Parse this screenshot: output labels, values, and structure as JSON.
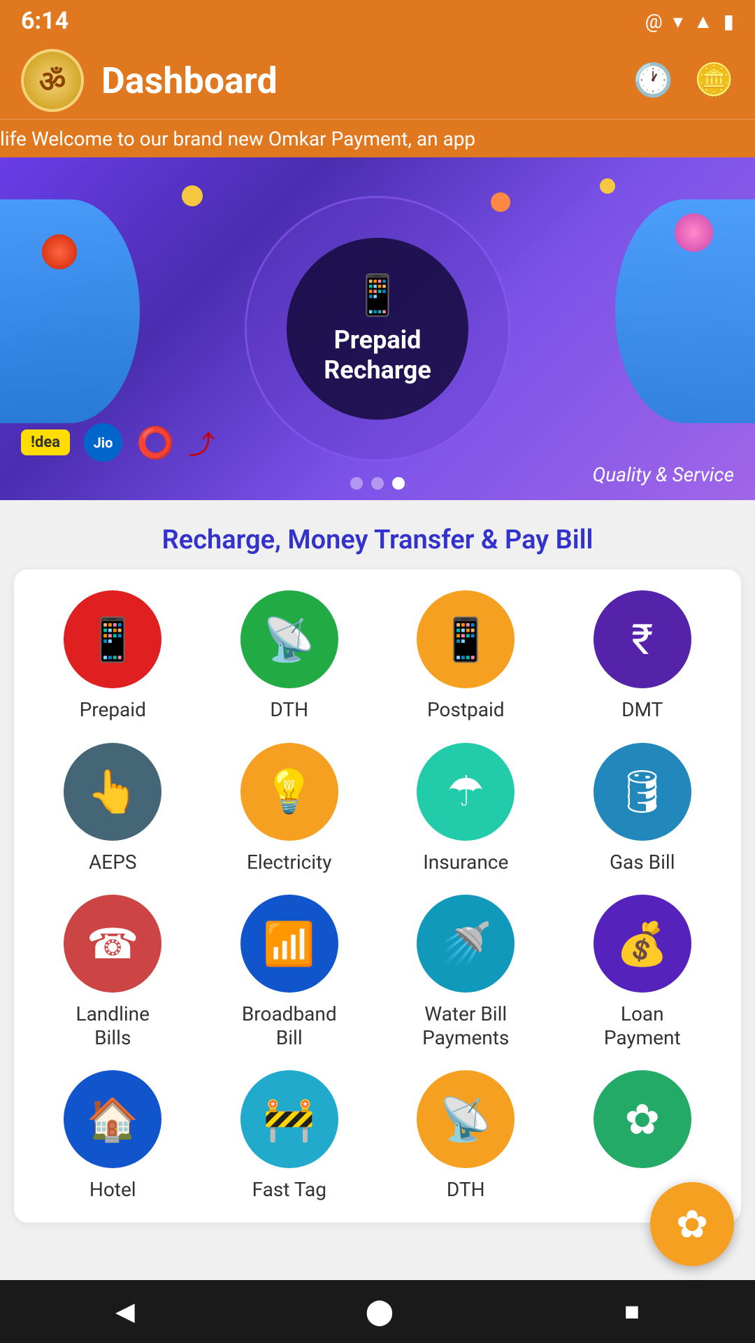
{
  "status": {
    "time": "6:14",
    "wifi_icon": "wifi",
    "signal_icon": "signal",
    "battery_icon": "battery"
  },
  "header": {
    "logo_text": "ॐ",
    "title": "Dashboard",
    "history_icon": "history",
    "wallet_icon": "wallet"
  },
  "marquee": {
    "text": "life   Welcome to our brand new Omkar Payment, an app"
  },
  "banner": {
    "title": "Prepaid\nRecharge",
    "phone_icon": "📱",
    "quality_text": "Quality & Service",
    "brands": [
      "!dea",
      "Jio",
      "Vodafone",
      "Airtel"
    ]
  },
  "section": {
    "title": "Recharge, Money Transfer & Pay Bill"
  },
  "services": [
    {
      "id": "prepaid",
      "label": "Prepaid",
      "icon": "📱",
      "color_class": "ic-prepaid"
    },
    {
      "id": "dth",
      "label": "DTH",
      "icon": "📡",
      "color_class": "ic-dth"
    },
    {
      "id": "postpaid",
      "label": "Postpaid",
      "icon": "📱",
      "color_class": "ic-postpaid"
    },
    {
      "id": "dmt",
      "label": "DMT",
      "icon": "₹",
      "color_class": "ic-dmt"
    },
    {
      "id": "aeps",
      "label": "AEPS",
      "icon": "👆",
      "color_class": "ic-aeps"
    },
    {
      "id": "electricity",
      "label": "Electricity",
      "icon": "💡",
      "color_class": "ic-electricity"
    },
    {
      "id": "insurance",
      "label": "Insurance",
      "icon": "☂",
      "color_class": "ic-insurance"
    },
    {
      "id": "gas",
      "label": "Gas Bill",
      "icon": "🛢",
      "color_class": "ic-gas"
    },
    {
      "id": "landline",
      "label": "Landline\nBills",
      "icon": "☎",
      "color_class": "ic-landline"
    },
    {
      "id": "broadband",
      "label": "Broadband\nBill",
      "icon": "📶",
      "color_class": "ic-broadband"
    },
    {
      "id": "water",
      "label": "Water Bill\nPayments",
      "icon": "🚿",
      "color_class": "ic-water"
    },
    {
      "id": "loan",
      "label": "Loan\nPayment",
      "icon": "💰",
      "color_class": "ic-loan"
    },
    {
      "id": "hotel",
      "label": "Hotel",
      "icon": "🏠",
      "color_class": "ic-hotel"
    },
    {
      "id": "fastag",
      "label": "Fast Tag",
      "icon": "🚧",
      "color_class": "ic-fastag"
    },
    {
      "id": "dth2",
      "label": "DTH",
      "icon": "📡",
      "color_class": "ic-dth2"
    },
    {
      "id": "fan",
      "label": "",
      "icon": "✿",
      "color_class": "ic-fan"
    }
  ],
  "nav": {
    "back": "◀",
    "home": "⬤",
    "recent": "■"
  }
}
